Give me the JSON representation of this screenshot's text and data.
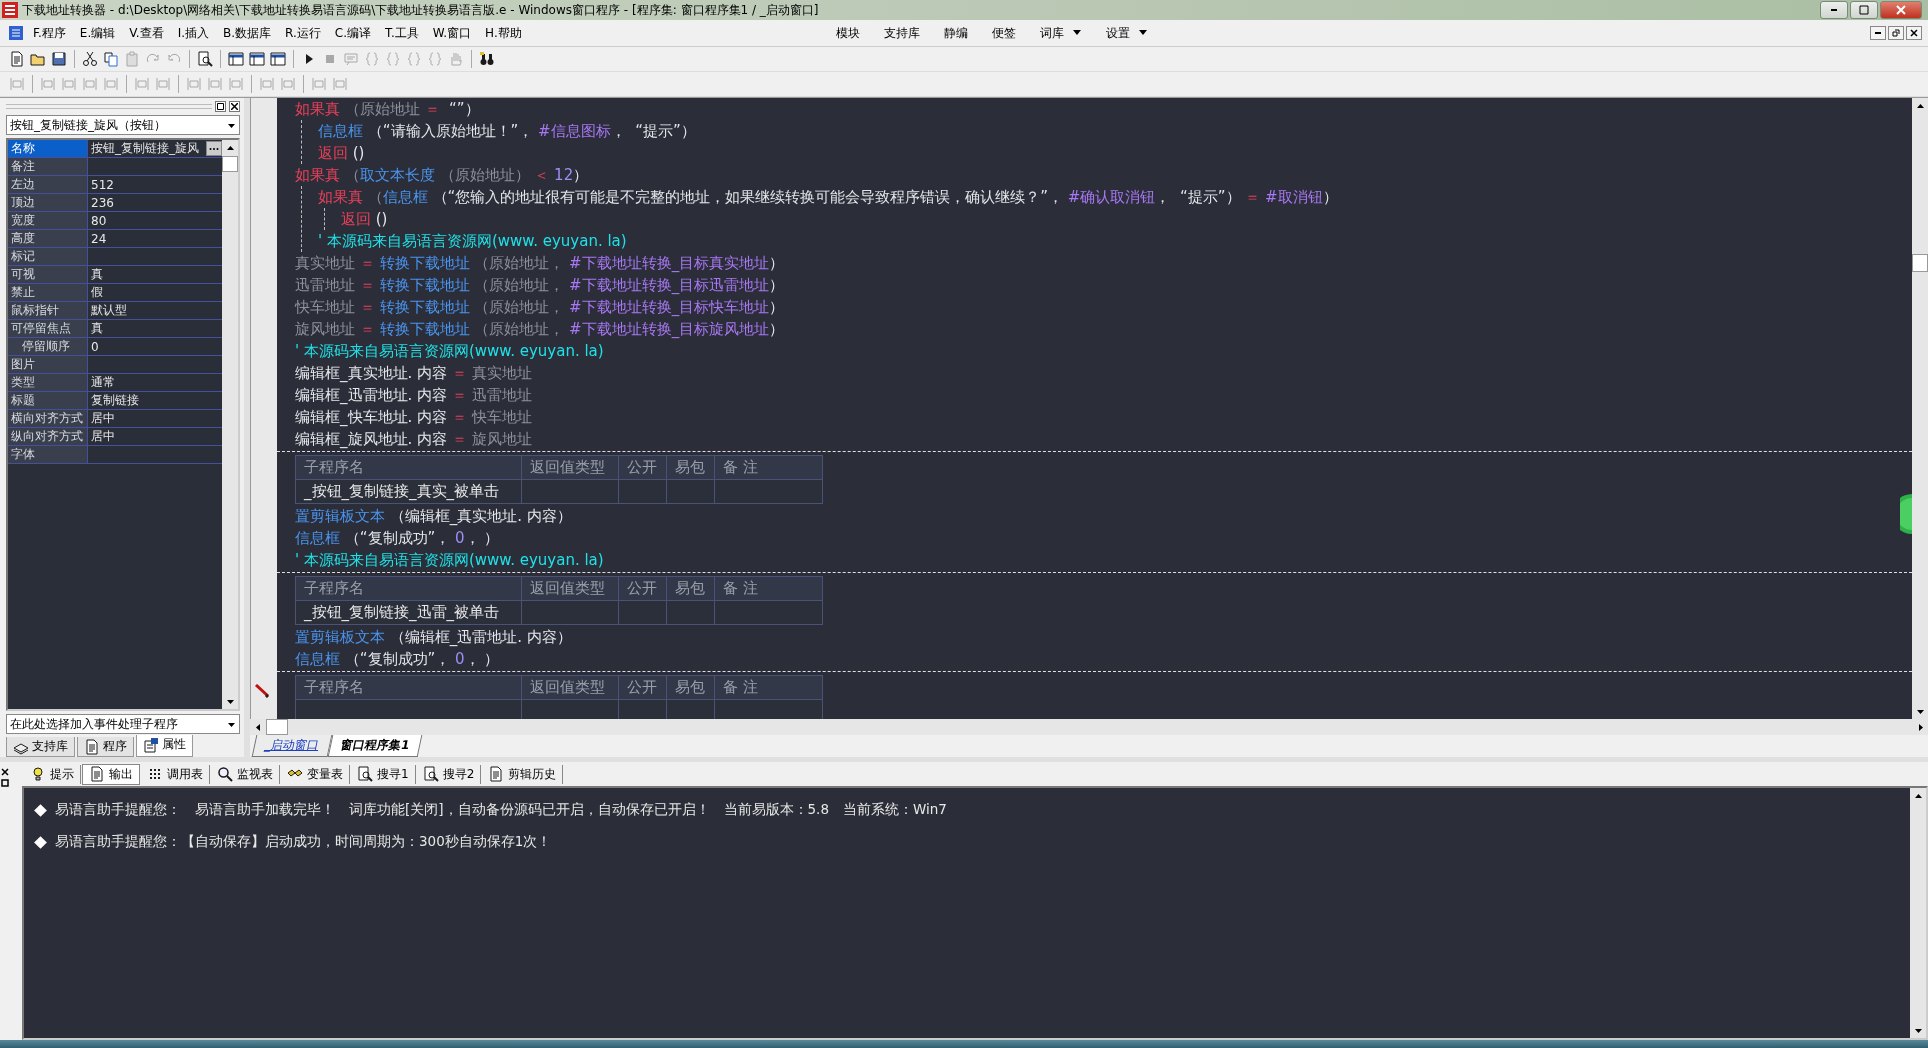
{
  "window": {
    "title": "下载地址转换器 - d:\\Desktop\\网络相关\\下载地址转换易语言源码\\下载地址转换易语言版.e - Windows窗口程序 - [程序集: 窗口程序集1 / _启动窗口]"
  },
  "menu": [
    "F.程序",
    "E.编辑",
    "V.查看",
    "I.插入",
    "B.数据库",
    "R.运行",
    "C.编译",
    "T.工具",
    "W.窗口",
    "H.帮助"
  ],
  "menu_right": [
    {
      "label": "模块",
      "dropdown": false
    },
    {
      "label": "支持库",
      "dropdown": false
    },
    {
      "label": "静编",
      "dropdown": false
    },
    {
      "label": "便签",
      "dropdown": false
    },
    {
      "label": "词库",
      "dropdown": true
    },
    {
      "label": "设置",
      "dropdown": true
    }
  ],
  "toolbar_1": [
    {
      "disabled": false
    },
    {
      "disabled": false
    },
    {
      "disabled": false
    },
    {
      "disabled": false
    },
    {
      "disabled": false
    },
    {
      "disabled": true
    },
    {
      "disabled": true
    },
    {
      "disabled": true
    },
    {
      "disabled": false
    },
    {
      "disabled": false
    },
    {
      "disabled": false
    },
    {
      "disabled": false
    },
    {
      "disabled": false
    },
    {
      "disabled": true
    },
    {
      "disabled": true
    },
    {
      "disabled": true
    },
    {
      "disabled": true
    },
    {
      "disabled": true
    },
    {
      "disabled": true
    },
    {
      "disabled": true
    },
    {
      "disabled": false
    }
  ],
  "toolbar_2": [
    {
      "disabled": true
    },
    {
      "disabled": true
    },
    {
      "disabled": true
    },
    {
      "disabled": true
    },
    {
      "disabled": true
    },
    {
      "disabled": true
    },
    {
      "disabled": true
    },
    {
      "disabled": true
    },
    {
      "disabled": true
    },
    {
      "disabled": true
    },
    {
      "disabled": true
    },
    {
      "disabled": true
    },
    {
      "disabled": true
    },
    {
      "disabled": true
    }
  ],
  "properties": {
    "object": "按钮_复制链接_旋风（按钮）",
    "rows": [
      {
        "name": "名称",
        "value": "按钮_复制链接_旋风",
        "selected": true
      },
      {
        "name": "备注",
        "selected": false
      },
      {
        "name": "左边",
        "value": "512",
        "selected": false
      },
      {
        "name": "顶边",
        "value": "236",
        "selected": false
      },
      {
        "name": "宽度",
        "value": "80",
        "selected": false
      },
      {
        "name": "高度",
        "value": "24",
        "selected": false
      },
      {
        "name": "标记",
        "selected": false
      },
      {
        "name": "可视",
        "value": "真",
        "selected": false
      },
      {
        "name": "禁止",
        "value": "假",
        "selected": false
      },
      {
        "name": "鼠标指针",
        "value": "默认型",
        "selected": false
      },
      {
        "name": "可停留焦点",
        "value": "真",
        "selected": false,
        "children": [
          {
            "name": "停留顺序",
            "value": "0",
            "selected": false
          }
        ]
      },
      {
        "name": "图片",
        "selected": false
      },
      {
        "name": "类型",
        "value": "通常",
        "selected": false
      },
      {
        "name": "标题",
        "value": "复制链接",
        "selected": false
      },
      {
        "name": "横向对齐方式",
        "value": "居中",
        "selected": false
      },
      {
        "name": "纵向对齐方式",
        "value": "居中",
        "selected": false
      },
      {
        "name": "字体",
        "selected": false
      }
    ],
    "event_select": "在此处选择加入事件处理子程序",
    "tabs": [
      {
        "label": "支持库",
        "selected": false
      },
      {
        "label": "程序",
        "selected": false
      },
      {
        "label": "属性",
        "selected": true
      }
    ]
  },
  "code": {
    "sections": [
      {
        "lines": [
          {
            "kind": "block",
            "head": [
              {
                "kind": "kw",
                "t": "如果真"
              },
              {
                "kind": "var",
                "t": " （原始地址"
              },
              {
                "kind": "op",
                "t": " ＝ "
              },
              {
                "kind": "text",
                "t": " “”）"
              }
            ],
            "children": [
              {
                "kind": "line",
                "tokens": [
                  {
                    "kind": "func",
                    "t": "信息框"
                  },
                  {
                    "kind": "text",
                    "t": " （“请输入原始地址！”， "
                  },
                  {
                    "kind": "const",
                    "t": "#信息图标"
                  },
                  {
                    "kind": "text",
                    "t": "，  “提示”）"
                  }
                ]
              },
              {
                "kind": "line",
                "tokens": [
                  {
                    "kind": "kw",
                    "t": "返回"
                  },
                  {
                    "kind": "text",
                    "t": " ()"
                  }
                ]
              }
            ]
          },
          {
            "kind": "block",
            "head": [
              {
                "kind": "kw",
                "t": "如果真"
              },
              {
                "kind": "var",
                "t": " （"
              },
              {
                "kind": "func",
                "t": "取文本长度"
              },
              {
                "kind": "var",
                "t": " （原始地址）"
              },
              {
                "kind": "op",
                "t": " ＜ "
              },
              {
                "kind": "num",
                "t": "12"
              },
              {
                "kind": "text",
                "t": "）"
              }
            ],
            "children": [
              {
                "kind": "block",
                "head": [
                  {
                    "kind": "kw",
                    "t": "如果真"
                  },
                  {
                    "kind": "var",
                    "t": " （"
                  },
                  {
                    "kind": "func",
                    "t": "信息框"
                  },
                  {
                    "kind": "text",
                    "t": " （“您输入的地址很有可能是不完整的地址，如果继续转换可能会导致程序错误，确认继续？”， "
                  },
                  {
                    "kind": "const",
                    "t": "#确认取消钮"
                  },
                  {
                    "kind": "text",
                    "t": "，  “提示”）"
                  },
                  {
                    "kind": "op",
                    "t": " ＝ "
                  },
                  {
                    "kind": "const",
                    "t": "#取消钮"
                  },
                  {
                    "kind": "text",
                    "t": "）"
                  }
                ],
                "children": [
                  {
                    "kind": "line",
                    "tokens": [
                      {
                        "kind": "kw",
                        "t": "返回"
                      },
                      {
                        "kind": "text",
                        "t": " ()"
                      }
                    ]
                  }
                ]
              },
              {
                "kind": "line",
                "tokens": [
                  {
                    "kind": "comment",
                    "t": "' 本源码来自易语言资源网(www. eyuyan. la)"
                  }
                ]
              }
            ]
          },
          {
            "kind": "line",
            "tokens": [
              {
                "kind": "var",
                "t": "真实地址"
              },
              {
                "kind": "op",
                "t": " ＝ "
              },
              {
                "kind": "func",
                "t": "转换下载地址"
              },
              {
                "kind": "var",
                "t": " （原始地址，"
              },
              {
                "kind": "const",
                "t": " #下载地址转换_目标真实地址"
              },
              {
                "kind": "text",
                "t": "）"
              }
            ]
          },
          {
            "kind": "line",
            "tokens": [
              {
                "kind": "var",
                "t": "迅雷地址"
              },
              {
                "kind": "op",
                "t": " ＝ "
              },
              {
                "kind": "func",
                "t": "转换下载地址"
              },
              {
                "kind": "var",
                "t": " （原始地址，"
              },
              {
                "kind": "const",
                "t": " #下载地址转换_目标迅雷地址"
              },
              {
                "kind": "text",
                "t": "）"
              }
            ]
          },
          {
            "kind": "line",
            "tokens": [
              {
                "kind": "var",
                "t": "快车地址"
              },
              {
                "kind": "op",
                "t": " ＝ "
              },
              {
                "kind": "func",
                "t": "转换下载地址"
              },
              {
                "kind": "var",
                "t": " （原始地址，"
              },
              {
                "kind": "const",
                "t": " #下载地址转换_目标快车地址"
              },
              {
                "kind": "text",
                "t": "）"
              }
            ]
          },
          {
            "kind": "line",
            "tokens": [
              {
                "kind": "var",
                "t": "旋风地址"
              },
              {
                "kind": "op",
                "t": " ＝ "
              },
              {
                "kind": "func",
                "t": "转换下载地址"
              },
              {
                "kind": "var",
                "t": " （原始地址，"
              },
              {
                "kind": "const",
                "t": " #下载地址转换_目标旋风地址"
              },
              {
                "kind": "text",
                "t": "）"
              }
            ]
          },
          {
            "kind": "line",
            "tokens": [
              {
                "kind": "comment",
                "t": "' 本源码来自易语言资源网(www. eyuyan. la)"
              }
            ]
          },
          {
            "kind": "line",
            "tokens": [
              {
                "kind": "text",
                "t": "编辑框_真实地址. 内容"
              },
              {
                "kind": "op",
                "t": " ＝ "
              },
              {
                "kind": "var",
                "t": "真实地址"
              }
            ]
          },
          {
            "kind": "line",
            "tokens": [
              {
                "kind": "text",
                "t": "编辑框_迅雷地址. 内容"
              },
              {
                "kind": "op",
                "t": " ＝ "
              },
              {
                "kind": "var",
                "t": "迅雷地址"
              }
            ]
          },
          {
            "kind": "line",
            "tokens": [
              {
                "kind": "text",
                "t": "编辑框_快车地址. 内容"
              },
              {
                "kind": "op",
                "t": " ＝ "
              },
              {
                "kind": "var",
                "t": "快车地址"
              }
            ]
          },
          {
            "kind": "line",
            "tokens": [
              {
                "kind": "text",
                "t": "编辑框_旋风地址. 内容"
              },
              {
                "kind": "op",
                "t": " ＝ "
              },
              {
                "kind": "var",
                "t": "旋风地址"
              }
            ]
          }
        ]
      },
      {
        "procedure": {
          "columns": [
            "子程序名",
            "返回值类型",
            "公开",
            "易包",
            "备 注"
          ],
          "name": "_按钮_复制链接_真实_被单击"
        },
        "lines": [
          {
            "kind": "line",
            "tokens": [
              {
                "kind": "func",
                "t": "置剪辑板文本"
              },
              {
                "kind": "text",
                "t": " （编辑框_真实地址. 内容）"
              }
            ]
          },
          {
            "kind": "line",
            "tokens": [
              {
                "kind": "func",
                "t": "信息框"
              },
              {
                "kind": "text",
                "t": " （“复制成功”， "
              },
              {
                "kind": "num",
                "t": "0"
              },
              {
                "kind": "text",
                "t": "， ）"
              }
            ]
          },
          {
            "kind": "line",
            "tokens": [
              {
                "kind": "comment",
                "t": "' 本源码来自易语言资源网(www. eyuyan. la)"
              }
            ]
          }
        ]
      },
      {
        "procedure": {
          "columns": [
            "子程序名",
            "返回值类型",
            "公开",
            "易包",
            "备 注"
          ],
          "name": "_按钮_复制链接_迅雷_被单击"
        },
        "lines": [
          {
            "kind": "line",
            "tokens": [
              {
                "kind": "func",
                "t": "置剪辑板文本"
              },
              {
                "kind": "text",
                "t": " （编辑框_迅雷地址. 内容）"
              }
            ]
          },
          {
            "kind": "line",
            "tokens": [
              {
                "kind": "func",
                "t": "信息框"
              },
              {
                "kind": "text",
                "t": " （“复制成功”， "
              },
              {
                "kind": "num",
                "t": "0"
              },
              {
                "kind": "text",
                "t": "， ）"
              }
            ]
          }
        ]
      },
      {
        "procedure": {
          "columns": [
            "子程序名",
            "返回值类型",
            "公开",
            "易包",
            "备 注"
          ]
        }
      }
    ]
  },
  "editor_tabs": [
    {
      "label": "_启动窗口",
      "selected": false
    },
    {
      "label": "窗口程序集1",
      "selected": true
    }
  ],
  "output_tabs": [
    {
      "label": "提示",
      "selected": false
    },
    {
      "label": "输出",
      "selected": true
    },
    {
      "label": "调用表",
      "selected": false
    },
    {
      "label": "监视表",
      "selected": false
    },
    {
      "label": "变量表",
      "selected": false
    },
    {
      "label": "搜寻1",
      "selected": false
    },
    {
      "label": "搜寻2",
      "selected": false
    },
    {
      "label": "剪辑历史",
      "selected": false
    }
  ],
  "output": [
    "易语言助手提醒您：　易语言助手加载完毕！　词库功能[关闭]，自动备份源码已开启，自动保存已开启！　当前易版本：5.8　当前系统：Win7",
    "易语言助手提醒您：【自动保存】启动成功，时间周期为：300秒自动保存1次！"
  ]
}
